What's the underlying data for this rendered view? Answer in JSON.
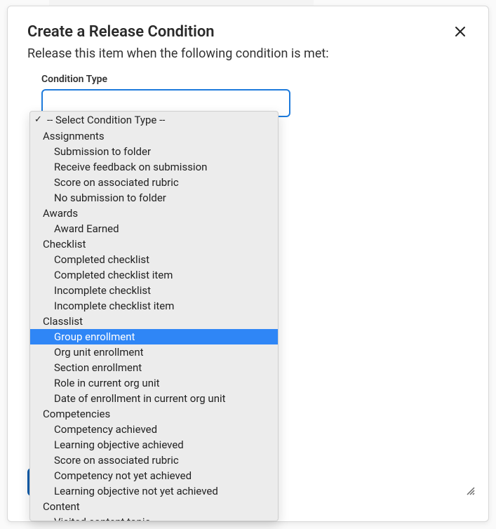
{
  "modal": {
    "title": "Create a Release Condition",
    "subheading": "Release this item when the following condition is met:",
    "field_label": "Condition Type"
  },
  "dropdown": {
    "placeholder": "-- Select Condition Type --",
    "highlighted": "Group enrollment",
    "groups": [
      {
        "name": "Assignments",
        "items": [
          "Submission to folder",
          "Receive feedback on submission",
          "Score on associated rubric",
          "No submission to folder"
        ]
      },
      {
        "name": "Awards",
        "items": [
          "Award Earned"
        ]
      },
      {
        "name": "Checklist",
        "items": [
          "Completed checklist",
          "Completed checklist item",
          "Incomplete checklist",
          "Incomplete checklist item"
        ]
      },
      {
        "name": "Classlist",
        "items": [
          "Group enrollment",
          "Org unit enrollment",
          "Section enrollment",
          "Role in current org unit",
          "Date of enrollment in current org unit"
        ]
      },
      {
        "name": "Competencies",
        "items": [
          "Competency achieved",
          "Learning objective achieved",
          "Score on associated rubric",
          "Competency not yet achieved",
          "Learning objective not yet achieved"
        ]
      },
      {
        "name": "Content",
        "items": [
          "Visited content topic"
        ]
      }
    ]
  }
}
